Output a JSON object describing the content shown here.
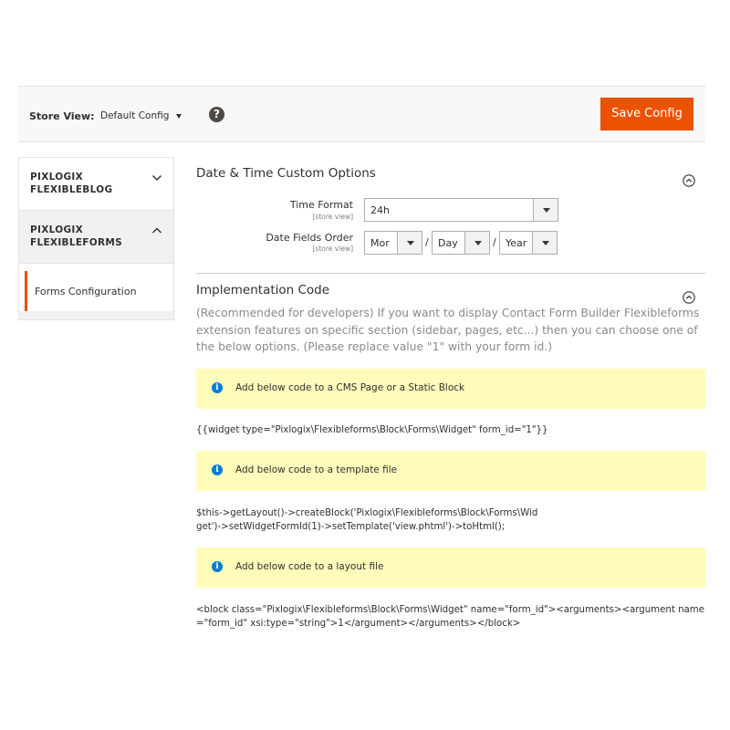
{
  "store_view": {
    "label": "Store View:",
    "selected": "Default Config",
    "help_glyph": "?",
    "save_label": "Save Config"
  },
  "sidebar": {
    "sections": [
      {
        "title": "PIXLOGIX FLEXIBLEBLOG",
        "expanded": false
      },
      {
        "title": "PIXLOGIX FLEXIBLEFORMS",
        "expanded": true
      }
    ],
    "active_item": "Forms Configuration"
  },
  "datetime": {
    "title": "Date & Time Custom Options",
    "time_format": {
      "label": "Time Format",
      "scope": "[store view]",
      "value": "24h"
    },
    "date_order": {
      "label": "Date Fields Order",
      "scope": "[store view]",
      "values": [
        "Mor",
        "Day",
        "Year"
      ],
      "separator": "/"
    }
  },
  "implementation": {
    "title": "Implementation Code",
    "description": "(Recommended for developers) If you want to display Contact Form Builder Flexibleforms extension features on specific section (sidebar, pages, etc...) then you can choose one of the below options. (Please replace value \"1\" with your form id.)",
    "blocks": [
      {
        "notice": "Add below code to a CMS Page or a Static Block",
        "code": "{{widget type=\"Pixlogix\\Flexibleforms\\Block\\Forms\\Widget\" form_id=\"1\"}}"
      },
      {
        "notice": "Add below code to a template file",
        "code": "$this->getLayout()->createBlock('Pixlogix\\Flexibleforms\\Block\\Forms\\Widget')->setWidgetFormId(1)->setTemplate('view.phtml')->toHtml();"
      },
      {
        "notice": "Add below code to a layout file",
        "code": "<block class=\"Pixlogix\\Flexibleforms\\Block\\Forms\\Widget\" name=\"form_id\"><arguments><argument name=\"form_id\" xsi:type=\"string\">1</argument></arguments></block>"
      }
    ],
    "info_glyph": "i"
  },
  "colors": {
    "accent": "#eb5202",
    "notice_bg": "#fffbbb",
    "info_icon": "#007bdb"
  }
}
